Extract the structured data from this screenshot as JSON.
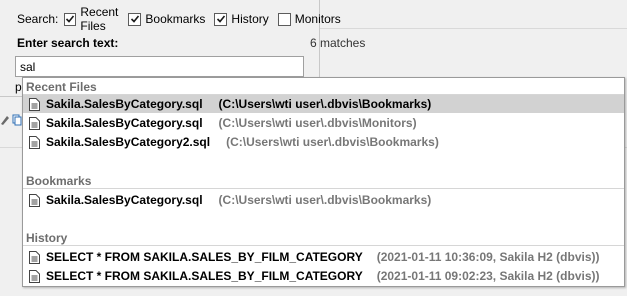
{
  "search": {
    "label": "Search:",
    "filters": [
      {
        "label": "Recent Files",
        "checked": true
      },
      {
        "label": "Bookmarks",
        "checked": true
      },
      {
        "label": "History",
        "checked": true
      },
      {
        "label": "Monitors",
        "checked": false
      }
    ],
    "enter_label": "Enter search text:",
    "matches": "6 matches",
    "query": "sal",
    "partial_text": "p"
  },
  "sections": {
    "recent": {
      "title": "Recent Files",
      "items": [
        {
          "name": "Sakila.SalesByCategory.sql",
          "path": "(C:\\Users\\wti user\\.dbvis\\Bookmarks)"
        },
        {
          "name": "Sakila.SalesByCategory.sql",
          "path": "(C:\\Users\\wti user\\.dbvis\\Monitors)"
        },
        {
          "name": "Sakila.SalesByCategory2.sql",
          "path": "(C:\\Users\\wti user\\.dbvis\\Bookmarks)"
        }
      ]
    },
    "bookmarks": {
      "title": "Bookmarks",
      "items": [
        {
          "name": "Sakila.SalesByCategory.sql",
          "path": "(C:\\Users\\wti user\\.dbvis\\Bookmarks)"
        }
      ]
    },
    "history": {
      "title": "History",
      "items": [
        {
          "name": "SELECT * FROM SAKILA.SALES_BY_FILM_CATEGORY",
          "path": "(2021-01-11 10:36:09,  Sakila H2 (dbvis))"
        },
        {
          "name": "SELECT * FROM SAKILA.SALES_BY_FILM_CATEGORY",
          "path": "(2021-01-11 09:02:23,  Sakila H2 (dbvis))"
        }
      ]
    }
  },
  "colors": {
    "selected_row": "#d2d2d2",
    "section_header": "#6d6d6d",
    "path_text": "#777777"
  }
}
